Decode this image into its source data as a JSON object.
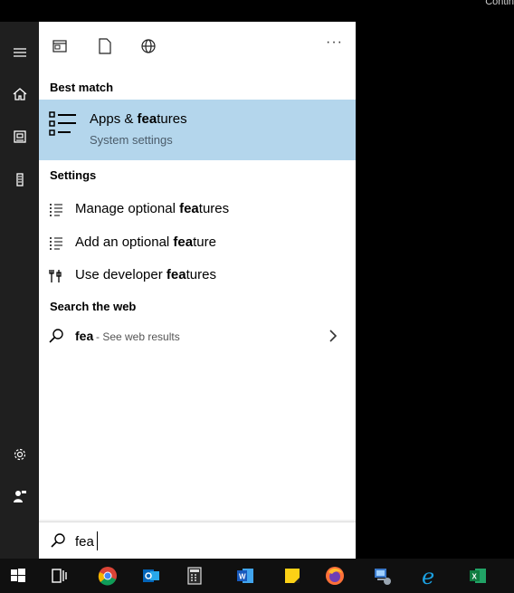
{
  "corner": {
    "text": "Contin"
  },
  "rail": {
    "items": [
      {
        "icon": "hamburger-menu-icon"
      },
      {
        "icon": "home-icon"
      },
      {
        "icon": "documents-icon"
      },
      {
        "icon": "mobile-device-icon"
      },
      {
        "icon": "settings-gear-icon"
      },
      {
        "icon": "user-account-icon"
      }
    ]
  },
  "filters": {
    "icons": [
      "apps-filter-icon",
      "documents-filter-icon",
      "web-filter-icon"
    ],
    "more_label": "···"
  },
  "best_match": {
    "header": "Best match",
    "title_prefix": "Apps & ",
    "title_bold": "fea",
    "title_suffix": "tures",
    "subtitle": "System settings",
    "icon": "apps-features-icon"
  },
  "settings": {
    "header": "Settings",
    "items": [
      {
        "prefix": "Manage optional ",
        "bold": "fea",
        "suffix": "tures",
        "icon": "list-icon"
      },
      {
        "prefix": "Add an optional ",
        "bold": "fea",
        "suffix": "ture",
        "icon": "list-icon"
      },
      {
        "prefix": "Use developer ",
        "bold": "fea",
        "suffix": "tures",
        "icon": "developer-tools-icon"
      }
    ]
  },
  "web": {
    "header": "Search the web",
    "query": "fea",
    "see_results": " - See web results"
  },
  "search": {
    "value": "fea",
    "placeholder": ""
  },
  "taskbar": {
    "items": [
      "start-windows-icon",
      "task-view-icon",
      "chrome-icon",
      "outlook-icon",
      "calculator-icon",
      "word-icon",
      "sticky-notes-icon",
      "firefox-icon",
      "network-icon",
      "edge-icon",
      "excel-icon"
    ]
  },
  "colors": {
    "accent_highlight": "#b4d6ec",
    "rail_bg": "#1f1f1f",
    "taskbar_bg": "#101010"
  }
}
